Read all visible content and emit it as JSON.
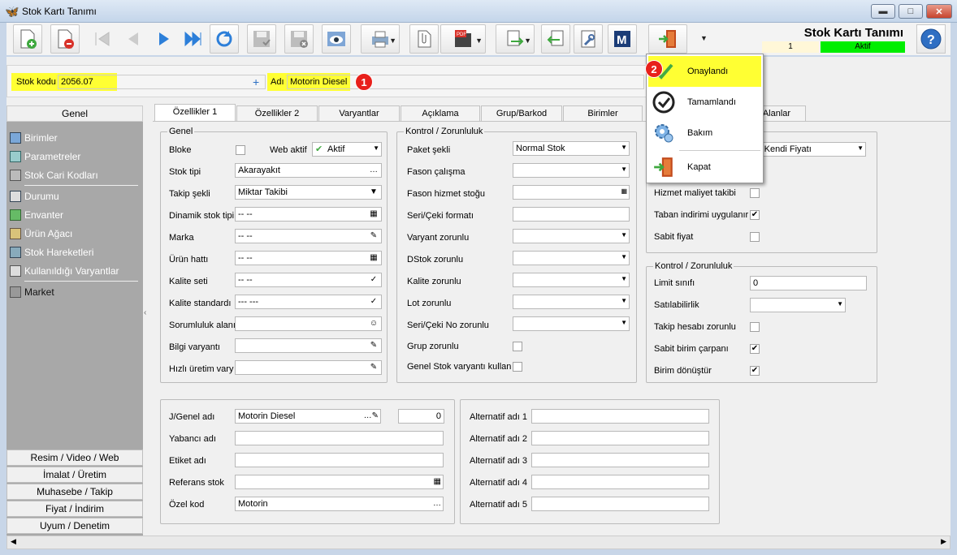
{
  "window": {
    "title": "Stok Kartı Tanımı"
  },
  "header": {
    "title": "Stok Kartı Tanımı",
    "record_number": "1",
    "status": "Aktif",
    "status_color": "#00ee00"
  },
  "stok": {
    "kod_label": "Stok kodu",
    "kod": "2056.07",
    "adi_label": "Adı",
    "adi": "Motorin Diesel"
  },
  "badges": {
    "one": "1",
    "two": "2"
  },
  "menu": {
    "items": [
      "Onaylandı",
      "Tamamlandı",
      "Bakım",
      "Kapat"
    ]
  },
  "left": {
    "header": "Genel",
    "items": [
      "Birimler",
      "Parametreler",
      "Stok Cari Kodları",
      "Durumu",
      "Envanter",
      "Ürün Ağacı",
      "Stok Hareketleri",
      "Kullanıldığı Varyantlar",
      "Market"
    ],
    "sections": [
      "Resim / Video / Web",
      "İmalat / Üretim",
      "Muhasebe / Takip",
      "Fiyat / İndirim",
      "Uyum / Denetim"
    ]
  },
  "tabs": [
    "Özellikler 1",
    "Özellikler 2",
    "Varyantlar",
    "Açıklama",
    "Grup/Barkod",
    "Birimler",
    "c Alanlar"
  ],
  "genel": {
    "title": "Genel",
    "bloke": "Bloke",
    "web_aktif": "Web aktif",
    "web_aktif_value": "Aktif",
    "rows": [
      {
        "label": "Stok tipi",
        "value": "Akarayakıt"
      },
      {
        "label": "Takip şekli",
        "value": "Miktar Takibi"
      },
      {
        "label": "Dinamik stok tipi",
        "value": "-- --"
      },
      {
        "label": "Marka",
        "value": "-- --"
      },
      {
        "label": "Ürün hattı",
        "value": "-- --"
      },
      {
        "label": "Kalite seti",
        "value": "-- --"
      },
      {
        "label": "Kalite standardı",
        "value": "--- ---"
      },
      {
        "label": "Sorumluluk alanı",
        "value": ""
      },
      {
        "label": "Bilgi varyantı",
        "value": ""
      },
      {
        "label": "Hızlı üretim vary",
        "value": ""
      }
    ]
  },
  "kontrol": {
    "title": "Kontrol / Zorunluluk",
    "rows": [
      {
        "label": "Paket şekli",
        "value": "Normal Stok"
      },
      {
        "label": "Fason çalışma",
        "value": ""
      },
      {
        "label": "Fason hizmet stoğu",
        "value": ""
      },
      {
        "label": "Seri/Çeki formatı",
        "value": ""
      },
      {
        "label": "Varyant zorunlu",
        "value": ""
      },
      {
        "label": "DStok zorunlu",
        "value": ""
      },
      {
        "label": "Kalite zorunlu",
        "value": ""
      },
      {
        "label": "Lot zorunlu",
        "value": ""
      },
      {
        "label": "Seri/Çeki No zorunlu",
        "value": ""
      }
    ],
    "grup_zorunlu": "Grup zorunlu",
    "genel_varyant": "Genel Stok varyantı kullan"
  },
  "right": {
    "fiyat_value": "ok Kendi Fiyatı",
    "checks": [
      {
        "label": "Hizmet maliyet takibi",
        "checked": false
      },
      {
        "label": "Taban indirimi uygulanır",
        "checked": true
      },
      {
        "label": "Sabit fiyat",
        "checked": false
      }
    ],
    "kontrol_title": "Kontrol / Zorunluluk",
    "limit_label": "Limit sınıfı",
    "limit_value": "0",
    "satilabilirlik": "Satılabilirlik",
    "checks2": [
      {
        "label": "Takip hesabı zorunlu",
        "checked": false
      },
      {
        "label": "Sabit birim çarpanı",
        "checked": true
      },
      {
        "label": "Birim dönüştür",
        "checked": true
      }
    ],
    "check_mark": "✔"
  },
  "names": {
    "jgenel_label": "J/Genel adı",
    "jgenel_value": "Motorin Diesel",
    "jgenel_num": "0",
    "yabanci": "Yabancı adı",
    "etiket": "Etiket adı",
    "referans": "Referans stok",
    "ozel_kod": "Özel kod",
    "ozel_kod_value": "Motorin"
  },
  "alternatif": [
    "Alternatif adı 1",
    "Alternatif adı 2",
    "Alternatif adı 3",
    "Alternatif adı 4",
    "Alternatif adı 5"
  ]
}
